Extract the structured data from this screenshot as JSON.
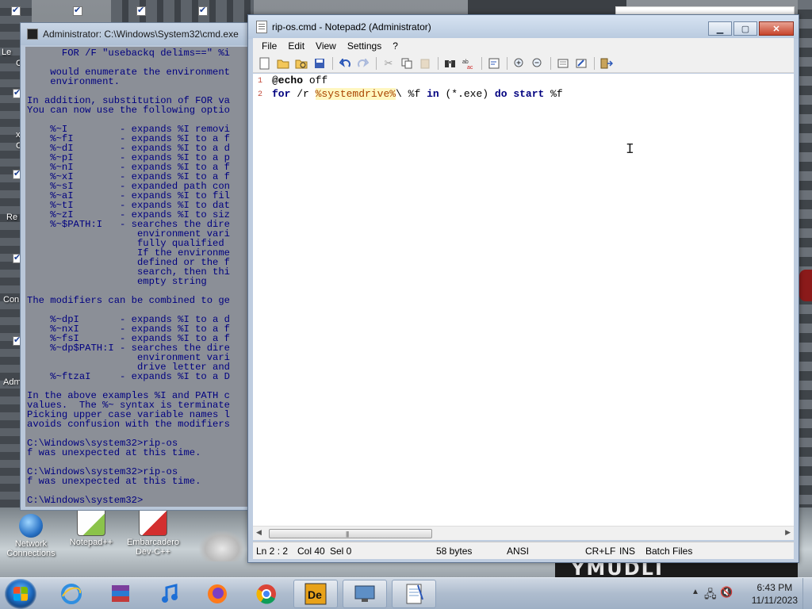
{
  "desktop": {
    "icons": [
      {
        "id": "network",
        "label_line1": "Network",
        "label_line2": "Connections"
      },
      {
        "id": "notepadpp",
        "label_line1": "Notepad++",
        "label_line2": ""
      },
      {
        "id": "devcpp",
        "label_line1": "Embarcadero",
        "label_line2": "Dev-C++"
      }
    ],
    "left_fragments": [
      "Le",
      "C",
      "x",
      "C",
      "Re",
      "Con",
      "Adm"
    ],
    "billboard_text": "YMUDLI"
  },
  "cmd": {
    "title": "Administrator: C:\\Windows\\System32\\cmd.exe",
    "lines": [
      "      FOR /F \"usebackq delims==\" %i",
      "",
      "    would enumerate the environment",
      "    environment.",
      "",
      "In addition, substitution of FOR va",
      "You can now use the following optio",
      "",
      "    %~I         - expands %I removi",
      "    %~fI        - expands %I to a f",
      "    %~dI        - expands %I to a d",
      "    %~pI        - expands %I to a p",
      "    %~nI        - expands %I to a f",
      "    %~xI        - expands %I to a f",
      "    %~sI        - expanded path con",
      "    %~aI        - expands %I to fil",
      "    %~tI        - expands %I to dat",
      "    %~zI        - expands %I to siz",
      "    %~$PATH:I   - searches the dire",
      "                   environment vari",
      "                   fully qualified",
      "                   If the environme",
      "                   defined or the f",
      "                   search, then thi",
      "                   empty string",
      "",
      "The modifiers can be combined to ge",
      "",
      "    %~dpI       - expands %I to a d",
      "    %~nxI       - expands %I to a f",
      "    %~fsI       - expands %I to a f",
      "    %~dp$PATH:I - searches the dire",
      "                   environment vari",
      "                   drive letter and",
      "    %~ftzaI     - expands %I to a D",
      "",
      "In the above examples %I and PATH c",
      "values.  The %~ syntax is terminate",
      "Picking upper case variable names l",
      "avoids confusion with the modifiers",
      "",
      "C:\\Windows\\system32>rip-os",
      "f was unexpected at this time.",
      "",
      "C:\\Windows\\system32>rip-os",
      "f was unexpected at this time.",
      "",
      "C:\\Windows\\system32>"
    ]
  },
  "notepad": {
    "title": "rip-os.cmd - Notepad2 (Administrator)",
    "menu": [
      "File",
      "Edit",
      "View",
      "Settings",
      "?"
    ],
    "toolbar_icons": [
      "new-icon",
      "open-icon",
      "browse-icon",
      "save-icon",
      "undo-icon",
      "redo-icon",
      "cut-icon",
      "copy-icon",
      "paste-icon",
      "find-icon",
      "replace-icon",
      "wordwrap-icon",
      "zoom-in-icon",
      "zoom-out-icon",
      "scheme-icon",
      "customize-icon",
      "exit-icon"
    ],
    "code": {
      "line1": {
        "num": "1",
        "kw": "@echo",
        "rest": " off"
      },
      "line2": {
        "num": "2",
        "kw_for": "for",
        "flag": " /r ",
        "var": "%systemdrive%",
        "p1": "\\ %f ",
        "kw_in": "in",
        "p2": " (*.exe) ",
        "kw_do": "do",
        "sp": " ",
        "kw_start": "start",
        "p3": " %f"
      }
    },
    "status": {
      "pos": "Ln 2 : 2",
      "col": "Col 40",
      "sel": "Sel 0",
      "size": "58 bytes",
      "encoding": "ANSI",
      "eol": "CR+LF",
      "mode": "INS",
      "scheme": "Batch Files"
    }
  },
  "taskbar": {
    "apps": [
      "internet-explorer",
      "winrar",
      "itunes",
      "firefox",
      "chrome",
      "embarcadero-dev",
      "remote-desktop",
      "notepad2"
    ],
    "time": "6:43 PM",
    "date": "11/11/2023"
  }
}
